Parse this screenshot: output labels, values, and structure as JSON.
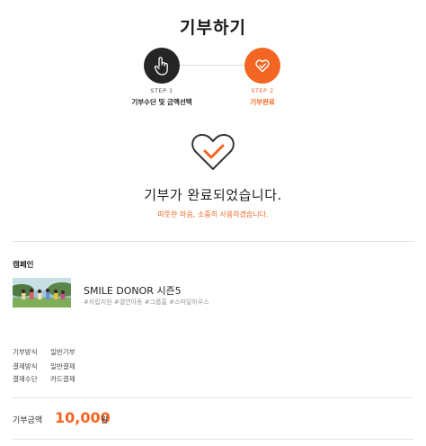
{
  "page": {
    "title": "기부하기"
  },
  "steps": [
    {
      "number": "STEP 1",
      "label": "기부수단 및 금액선택",
      "icon": "hand-pointer-icon"
    },
    {
      "number": "STEP 2",
      "label": "기부완료",
      "icon": "heart-check-icon"
    }
  ],
  "completion": {
    "icon": "heart-check-icon",
    "message": "기부가 완료되었습니다.",
    "submessage": "따뜻한 마음, 소중히 사용하겠습니다."
  },
  "campaign": {
    "section_title": "캠페인",
    "name": "SMILE DONOR 시즌5",
    "tags": "#자립지원 #결연아동 #그룹홈 #스마일하우스"
  },
  "details": [
    {
      "label": "기부방식",
      "value": "일반기부"
    },
    {
      "label": "결제방식",
      "value": "일반결제"
    },
    {
      "label": "결제수단",
      "value": "카드결제"
    }
  ],
  "amount": {
    "label": "기부금액",
    "value": "10,000",
    "unit": "원"
  },
  "colors": {
    "accent": "#f26522",
    "dark": "#252525",
    "divider": "#e2e2e2"
  }
}
